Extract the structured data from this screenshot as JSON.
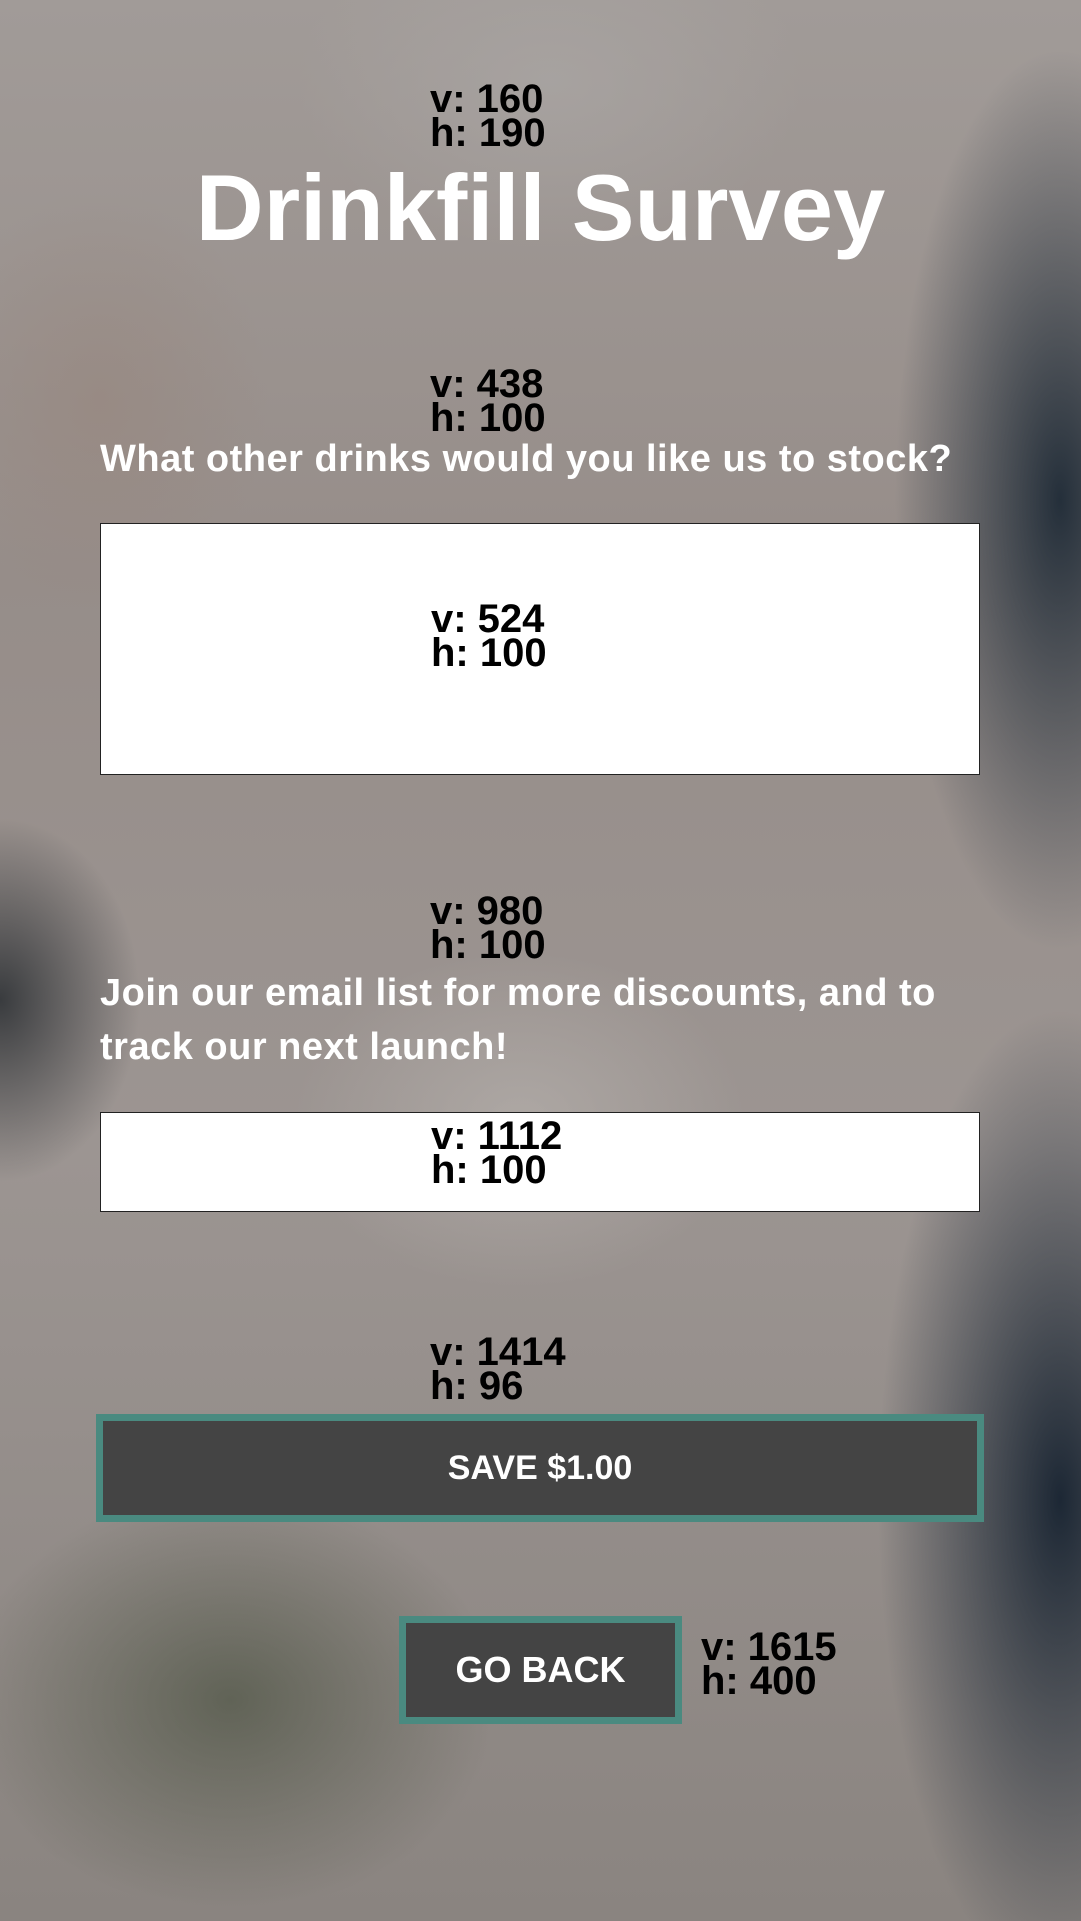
{
  "header": {
    "debug_v": "v: 160",
    "debug_h": "h: 190",
    "title": "Drinkfill Survey"
  },
  "question_drinks": {
    "debug_v": "v: 438",
    "debug_h": "h: 100",
    "label": "What other drinks would you like us to stock?",
    "field_debug_v": "v: 524",
    "field_debug_h": "h: 100"
  },
  "question_email": {
    "debug_v": "v: 980",
    "debug_h": "h: 100",
    "label": "Join our email list for more discounts, and to track our next launch!",
    "field_debug_v": "v: 1112",
    "field_debug_h": "h: 100"
  },
  "save_button": {
    "debug_v": "v: 1414",
    "debug_h": "h: 96",
    "label": "SAVE $1.00"
  },
  "back_button": {
    "label": "GO BACK",
    "debug_v": "v: 1615",
    "debug_h": "h: 400"
  },
  "colors": {
    "button_bg": "#444444",
    "button_border": "#4a8a80",
    "text_light": "#ffffff"
  }
}
